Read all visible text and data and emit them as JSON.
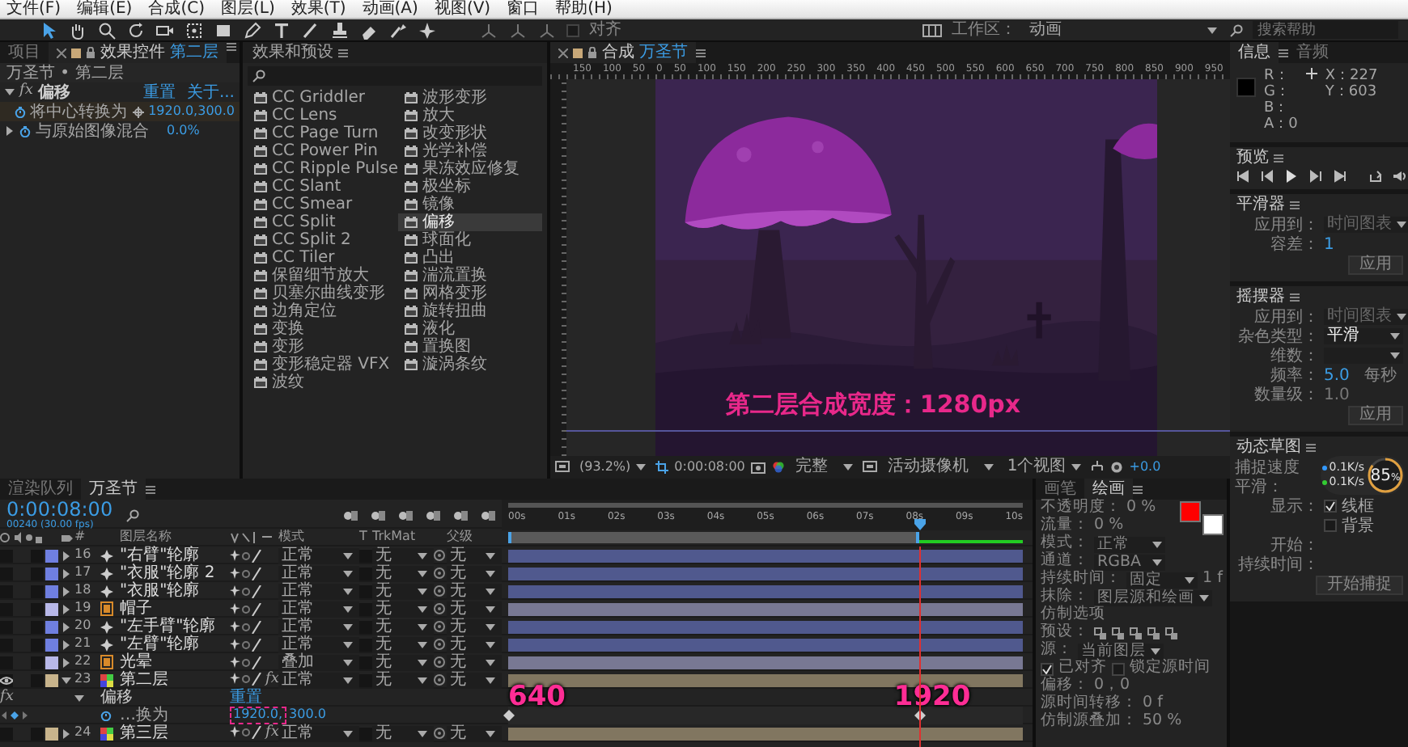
{
  "menu": [
    "文件(F)",
    "编辑(E)",
    "合成(C)",
    "图层(L)",
    "效果(T)",
    "动画(A)",
    "视图(V)",
    "窗口",
    "帮助(H)"
  ],
  "toolbar": {
    "snap": {
      "label": "对齐",
      "checked": false
    },
    "workspace_label": "工作区：",
    "workspace": "动画",
    "search_placeholder": "搜索帮助"
  },
  "effect_controls": {
    "tabs": [
      {
        "label": "项目",
        "selected": false
      },
      {
        "label": "效果控件",
        "target": "第二层",
        "selected": true
      }
    ],
    "breadcrumb": "万圣节 • 第二层",
    "effect": {
      "badge": "fx",
      "name": "偏移",
      "expanded": true,
      "reset": "重置",
      "about": "关于..."
    },
    "properties": [
      {
        "kind": "point",
        "name": "将中心转换为",
        "value": "1920.0,300.0",
        "selected": true
      },
      {
        "kind": "number",
        "name": "与原始图像混合",
        "value": "0.0%",
        "selected": false
      }
    ]
  },
  "effects_panel": {
    "title": "效果和预设",
    "items": [
      {
        "label": "CC Griddler",
        "selected": false
      },
      {
        "label": "CC Lens",
        "selected": false
      },
      {
        "label": "CC Page Turn",
        "selected": false
      },
      {
        "label": "CC Power Pin",
        "selected": false
      },
      {
        "label": "CC Ripple Pulse",
        "selected": false
      },
      {
        "label": "CC Slant",
        "selected": false
      },
      {
        "label": "CC Smear",
        "selected": false
      },
      {
        "label": "CC Split",
        "selected": false
      },
      {
        "label": "CC Split 2",
        "selected": false
      },
      {
        "label": "CC Tiler",
        "selected": false
      },
      {
        "label": "保留细节放大",
        "selected": false
      },
      {
        "label": "贝塞尔曲线变形",
        "selected": false
      },
      {
        "label": "边角定位",
        "selected": false
      },
      {
        "label": "变换",
        "selected": false
      },
      {
        "label": "变形",
        "selected": false
      },
      {
        "label": "变形稳定器 VFX",
        "selected": false
      },
      {
        "label": "波纹",
        "selected": false
      },
      {
        "label": "波形变形",
        "selected": false
      },
      {
        "label": "放大",
        "selected": false
      },
      {
        "label": "改变形状",
        "selected": false
      },
      {
        "label": "光学补偿",
        "selected": false
      },
      {
        "label": "果冻效应修复",
        "selected": false
      },
      {
        "label": "极坐标",
        "selected": false
      },
      {
        "label": "镜像",
        "selected": false
      },
      {
        "label": "偏移",
        "selected": true
      },
      {
        "label": "球面化",
        "selected": false
      },
      {
        "label": "凸出",
        "selected": false
      },
      {
        "label": "湍流置换",
        "selected": false
      },
      {
        "label": "网格变形",
        "selected": false
      },
      {
        "label": "旋转扭曲",
        "selected": false
      },
      {
        "label": "液化",
        "selected": false
      },
      {
        "label": "置换图",
        "selected": false
      },
      {
        "label": "漩涡条纹",
        "selected": false
      }
    ]
  },
  "viewer": {
    "tab": {
      "label": "合成",
      "target": "万圣节"
    },
    "ruler": [
      "150",
      "100",
      "50",
      "0",
      "50",
      "100",
      "150",
      "200",
      "250",
      "300",
      "350",
      "400",
      "450",
      "500",
      "550",
      "600",
      "650",
      "700",
      "750",
      "800",
      "850",
      "900",
      "950"
    ],
    "caption": "第二层合成宽度：1280px",
    "zoom": "(93.2%)",
    "timecode": "0:00:08:00",
    "resolution": "完整",
    "camera": "活动摄像机",
    "views": "1个视图",
    "exposure": "+0.0"
  },
  "info": {
    "tabs": [
      {
        "label": "信息",
        "selected": true
      },
      {
        "label": "音频",
        "selected": false
      }
    ],
    "channels": [
      "R：",
      "G：",
      "B：",
      "A：0"
    ],
    "coords": [
      "X：227",
      "Y：603"
    ]
  },
  "preview": {
    "title": "预览"
  },
  "smoother": {
    "title": "平滑器",
    "apply_to_label": "应用到：",
    "apply_to": "时间图表",
    "tolerance_label": "容差：",
    "tolerance": "1",
    "apply": "应用"
  },
  "wiggler": {
    "title": "摇摆器",
    "apply_to_label": "应用到：",
    "apply_to": "时间图表",
    "noise_label": "杂色类型：",
    "noise": "平滑",
    "dimension_label": "维数：",
    "frequency_label": "频率：",
    "frequency": "5.0",
    "per_second": "每秒",
    "magnitude_label": "数量级：",
    "magnitude": "1.0",
    "apply": "应用"
  },
  "motion_sketch": {
    "title": "动态草图",
    "capture_speed_label": "捕捉速度",
    "smoothing_label": "平滑：",
    "show_label": "显示：",
    "options": [
      {
        "label": "线框",
        "checked": true
      },
      {
        "label": "背景",
        "checked": false
      }
    ],
    "start_label": "开始：",
    "duration_label": "持续时间：",
    "start_capture": "开始捕捉"
  },
  "gauge": {
    "up": "0.1K/s",
    "down": "0.1K/s",
    "percent": "85",
    "unit": "%"
  },
  "timeline": {
    "tabs": [
      {
        "label": "渲染队列",
        "selected": false
      },
      {
        "label": "万圣节",
        "selected": true
      }
    ],
    "timecode": "0:00:08:00",
    "fps": "00240 (30.00 fps)",
    "columns": [
      "#",
      "图层名称",
      "模式",
      "T",
      "TrkMat",
      "父级"
    ],
    "time_ticks": [
      "00s",
      "01s",
      "02s",
      "03s",
      "04s",
      "05s",
      "06s",
      "07s",
      "08s",
      "09s",
      "10s"
    ],
    "playhead": {
      "level": 0.8
    },
    "work_area": {
      "level": 0.8
    },
    "layers": [
      {
        "kind": "shape_layer",
        "number": "16",
        "name": "\"右臂\"轮廓",
        "color": "#6f7fe0",
        "mode": "正常",
        "trkmat": "无",
        "parent": "无",
        "visible": false,
        "expanded": false
      },
      {
        "kind": "shape_layer",
        "number": "17",
        "name": "\"衣服\"轮廓 2",
        "color": "#6f7fe0",
        "mode": "正常",
        "trkmat": "无",
        "parent": "无",
        "visible": false,
        "expanded": false
      },
      {
        "kind": "shape_layer",
        "number": "18",
        "name": "\"衣服\"轮廓",
        "color": "#6f7fe0",
        "mode": "正常",
        "trkmat": "无",
        "parent": "无",
        "visible": false,
        "expanded": false
      },
      {
        "kind": "image_layer",
        "number": "19",
        "name": "帽子",
        "color": "#b8b8e8",
        "mode": "正常",
        "trkmat": "无",
        "parent": "无",
        "visible": false,
        "expanded": false
      },
      {
        "kind": "shape_layer",
        "number": "20",
        "name": "\"左手臂\"轮廓",
        "color": "#6f7fe0",
        "mode": "正常",
        "trkmat": "无",
        "parent": "无",
        "visible": false,
        "expanded": false
      },
      {
        "kind": "shape_layer",
        "number": "21",
        "name": "\"左臂\"轮廓",
        "color": "#6f7fe0",
        "mode": "正常",
        "trkmat": "无",
        "parent": "无",
        "visible": false,
        "expanded": false
      },
      {
        "kind": "image_layer",
        "number": "22",
        "name": "光晕",
        "color": "#b8b8e8",
        "mode": "叠加",
        "trkmat": "无",
        "parent": "无",
        "visible": false,
        "expanded": false
      },
      {
        "kind": "comp_layer",
        "number": "23",
        "name": "第二层",
        "color": "#c8b48c",
        "mode": "正常",
        "trkmat": "无",
        "parent": "无",
        "visible": true,
        "expanded": true,
        "fx_badge": "fx"
      },
      {
        "kind": "effect",
        "badge": "fx",
        "name": "偏移",
        "reset": "重置"
      },
      {
        "kind": "property",
        "name": "…换为",
        "values": [
          {
            "text": "1920.0,",
            "highlighted": true
          },
          {
            "text": "300.0",
            "highlighted": false
          }
        ],
        "keyframes": [
          {
            "level": 0,
            "label": "640"
          },
          {
            "level": 0.8,
            "label": "1920"
          }
        ]
      },
      {
        "kind": "comp_layer",
        "number": "24",
        "name": "第三层",
        "color": "#c8b48c",
        "mode": "正常",
        "trkmat": "无",
        "parent": "无",
        "visible": false,
        "expanded": false,
        "fx_badge": "fx"
      }
    ]
  },
  "paint": {
    "tabs": [
      {
        "label": "画笔",
        "selected": false
      },
      {
        "label": "绘画",
        "selected": true
      }
    ],
    "swatches": [
      {
        "kind": "foreground",
        "color": "#ff0000"
      },
      {
        "kind": "background",
        "color": "#ffffff"
      }
    ],
    "rows": [
      {
        "kind": "value",
        "label": "不透明度：",
        "value": "0 %"
      },
      {
        "kind": "value",
        "label": "流量：",
        "value": "0 %"
      },
      {
        "kind": "dropdown",
        "label": "模式：",
        "value": "正常"
      },
      {
        "kind": "dropdown",
        "label": "通道：",
        "value": "RGBA"
      },
      {
        "kind": "dropdown",
        "label": "持续时间：",
        "value": "固定",
        "extra": "1 f"
      },
      {
        "kind": "dropdown",
        "label": "抹除：",
        "value": "图层源和绘画"
      },
      {
        "kind": "section",
        "label": "仿制选项"
      },
      {
        "kind": "presets",
        "label": "预设："
      },
      {
        "kind": "dropdown",
        "label": "源：",
        "value": "当前图层"
      },
      {
        "kind": "checks",
        "items": [
          {
            "label": "已对齐",
            "checked": true
          },
          {
            "label": "锁定源时间",
            "checked": false
          }
        ]
      },
      {
        "kind": "value",
        "label": "偏移：",
        "value": "0，0"
      },
      {
        "kind": "value",
        "label": "源时间转移：",
        "value": "0 f"
      },
      {
        "kind": "value",
        "label": "仿制源叠加：",
        "value": "50 %"
      }
    ]
  }
}
